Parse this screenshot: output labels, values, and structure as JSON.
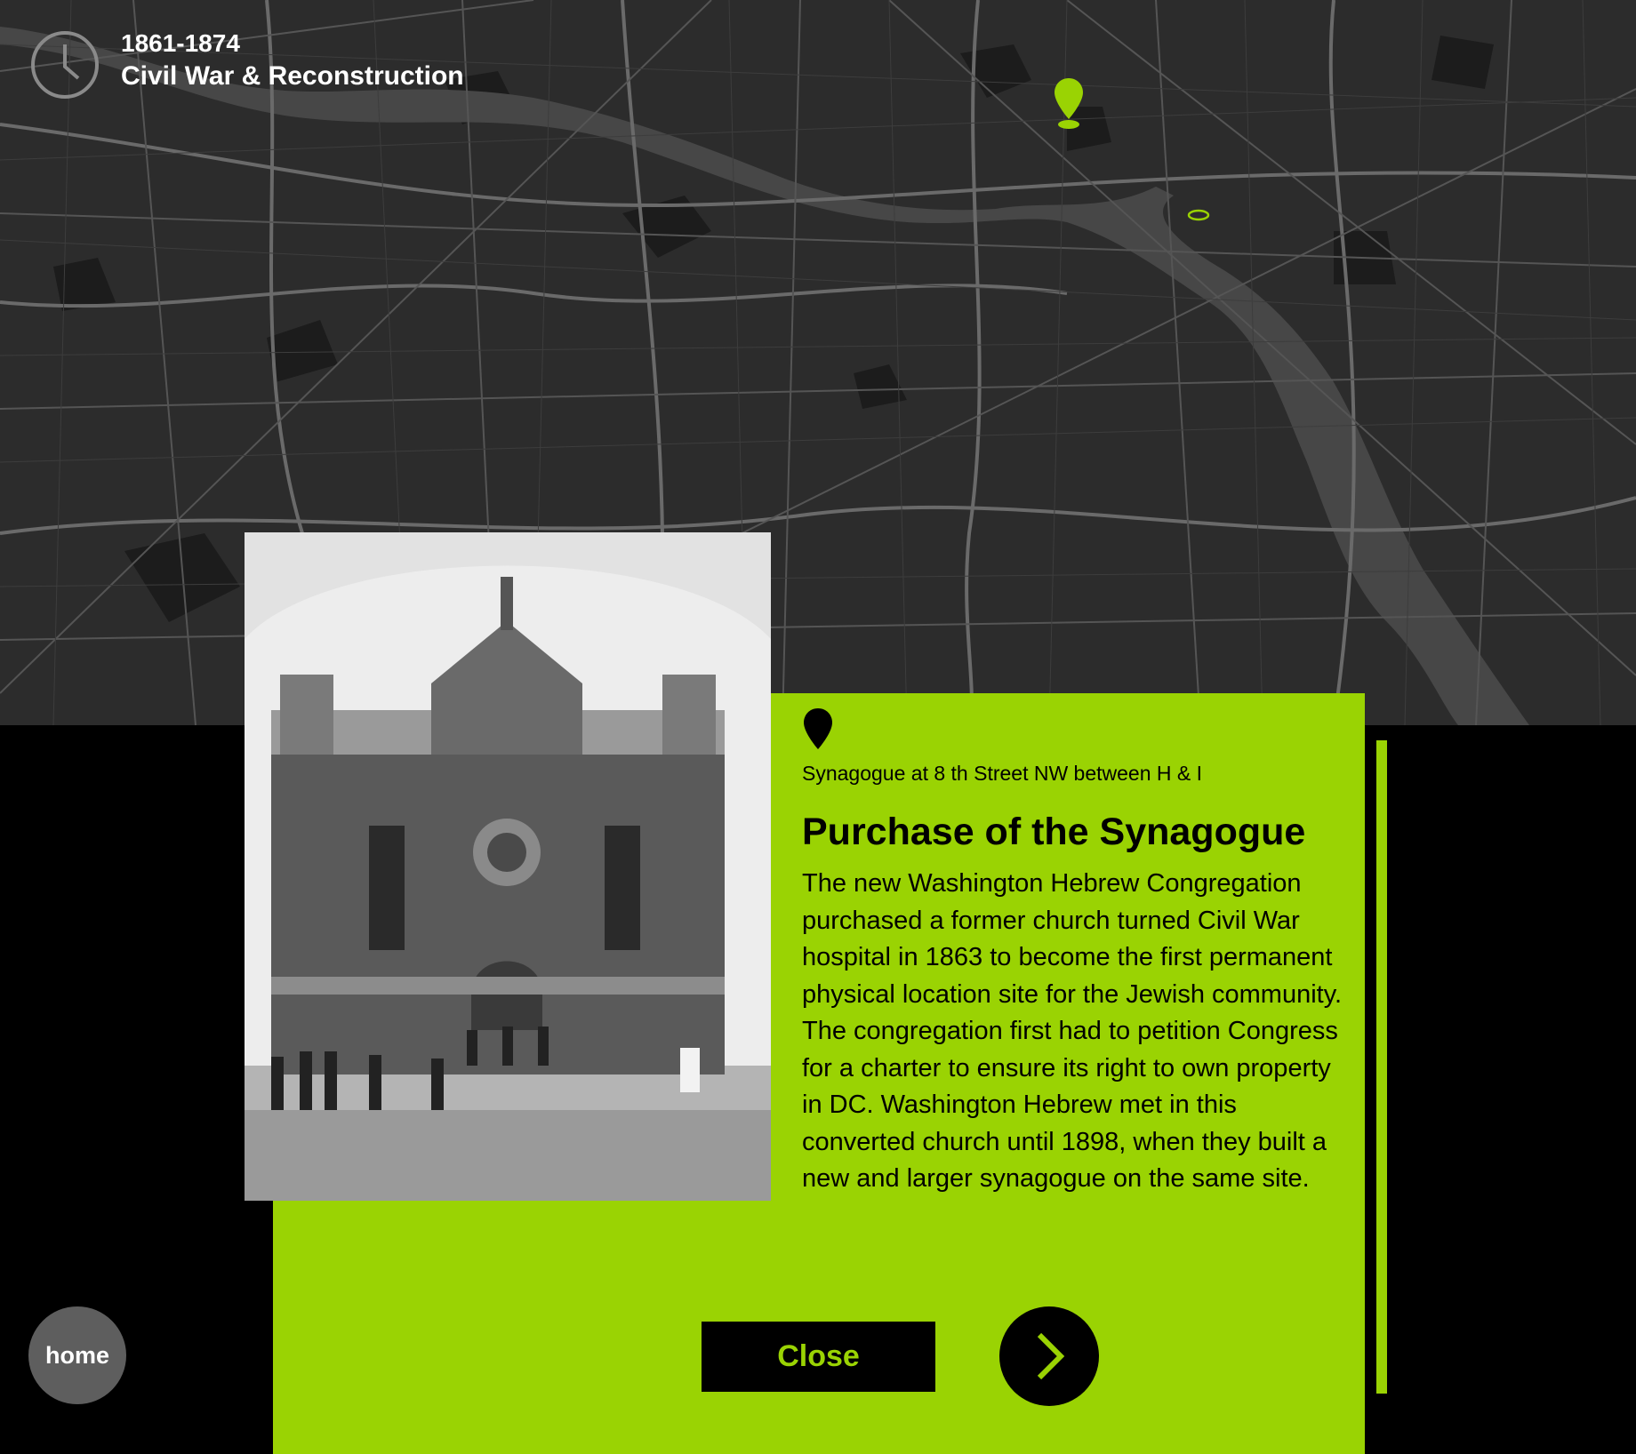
{
  "era": {
    "years": "1861-1874",
    "title": "Civil War & Reconstruction"
  },
  "location": {
    "label": "Synagogue at 8 th Street NW between H & I"
  },
  "story": {
    "heading": "Purchase of the Synagogue",
    "body": "The new Washington Hebrew Congregation purchased a former church turned Civil War hospital in 1863 to become the first permanent physical location site for the Jewish community. The congregation first had to petition Congress for a charter to ensure its right to own property in DC. Washington Hebrew met in this converted church until 1898, when they built a new and larger synagogue on the same site."
  },
  "buttons": {
    "close": "Close",
    "home": "home"
  },
  "icons": {
    "clock": "clock-icon",
    "map_pin": "map-pin-icon",
    "location": "location-pin-icon",
    "next": "chevron-right-icon"
  },
  "colors": {
    "accent": "#9ad303",
    "map_bg": "#2c2c2c",
    "panel_text": "#000000",
    "home_bg": "#5e5e5e"
  }
}
